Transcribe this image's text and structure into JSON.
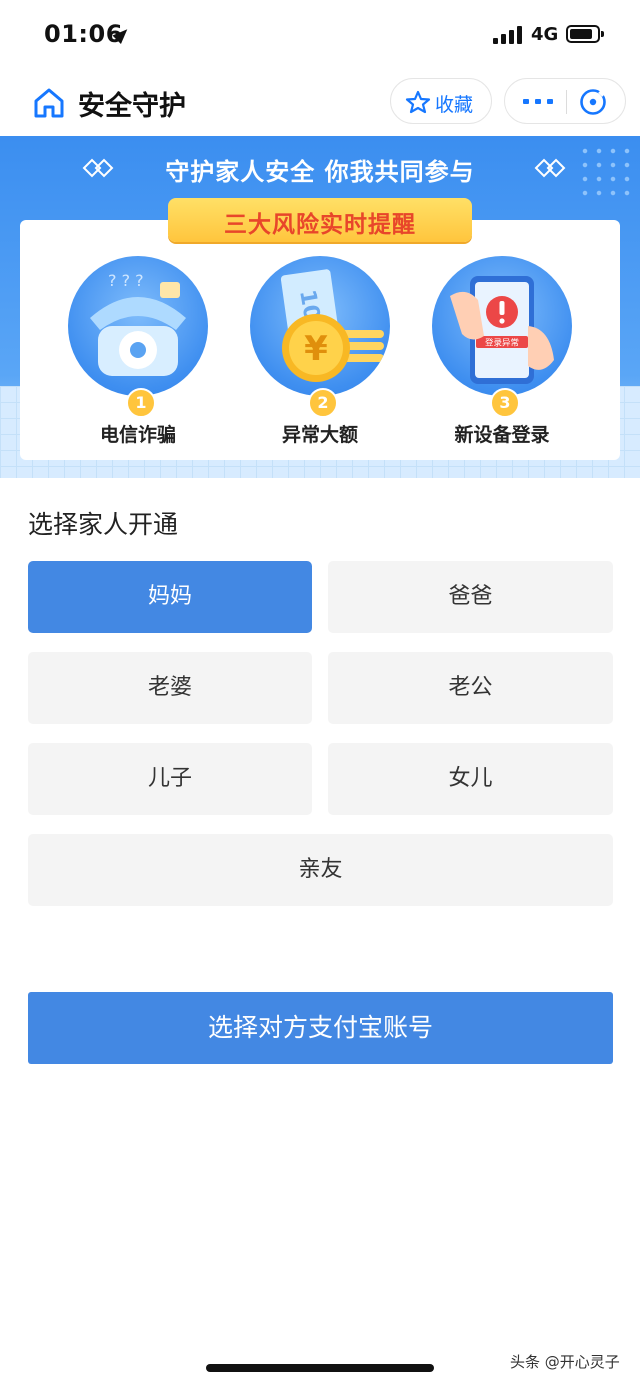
{
  "status": {
    "time": "01:06",
    "network": "4G"
  },
  "header": {
    "title": "安全守护",
    "favorite_label": "收藏"
  },
  "banner": {
    "slogan": "守护家人安全 你我共同参与",
    "headline": "三大风险实时提醒",
    "risks": [
      {
        "num": "1",
        "label": "电信诈骗",
        "icon": "telephone-icon"
      },
      {
        "num": "2",
        "label": "异常大额",
        "icon": "yuan-coin-icon"
      },
      {
        "num": "3",
        "label": "新设备登录",
        "icon": "phone-alert-icon"
      }
    ],
    "alert_badge_text": "登录异常"
  },
  "family": {
    "title": "选择家人开通",
    "options": [
      "妈妈",
      "爸爸",
      "老婆",
      "老公",
      "儿子",
      "女儿",
      "亲友"
    ],
    "selected": "妈妈"
  },
  "action": {
    "label": "选择对方支付宝账号"
  },
  "watermark": "头条 @开心灵子",
  "colors": {
    "accent": "#4388e3",
    "link": "#1677ff",
    "pill_text": "#e8462a"
  }
}
